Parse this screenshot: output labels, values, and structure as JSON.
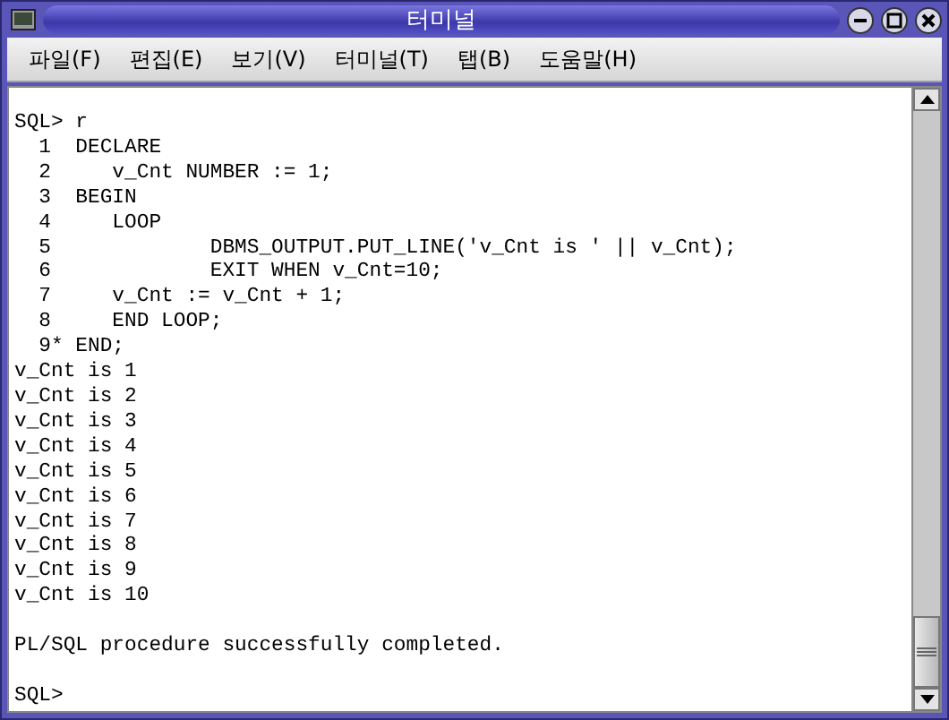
{
  "window": {
    "title": "터미널"
  },
  "menu": [
    {
      "label": "파일(F)"
    },
    {
      "label": "편집(E)"
    },
    {
      "label": "보기(V)"
    },
    {
      "label": "터미널(T)"
    },
    {
      "label": "탭(B)"
    },
    {
      "label": "도움말(H)"
    }
  ],
  "terminal": {
    "blocks": [
      {
        "lines": [
          "SQL> r",
          "  1  DECLARE",
          "  2     v_Cnt NUMBER := 1;",
          "  3  BEGIN",
          "  4     LOOP",
          "  5             DBMS_OUTPUT.PUT_LINE('v_Cnt is ' || v_Cnt);",
          "  6             EXIT WHEN v_Cnt=10;",
          "  7     v_Cnt := v_Cnt + 1;",
          "  8     END LOOP;",
          "  9* END;",
          "v_Cnt is 1",
          "v_Cnt is 2",
          "v_Cnt is 3",
          "v_Cnt is 4",
          "v_Cnt is 5",
          "v_Cnt is 6",
          "v_Cnt is 7",
          "v_Cnt is 8",
          "v_Cnt is 9",
          "v_Cnt is 10"
        ]
      },
      {
        "lines": [
          "PL/SQL procedure successfully completed."
        ]
      },
      {
        "lines": [
          "SQL>"
        ]
      }
    ]
  }
}
